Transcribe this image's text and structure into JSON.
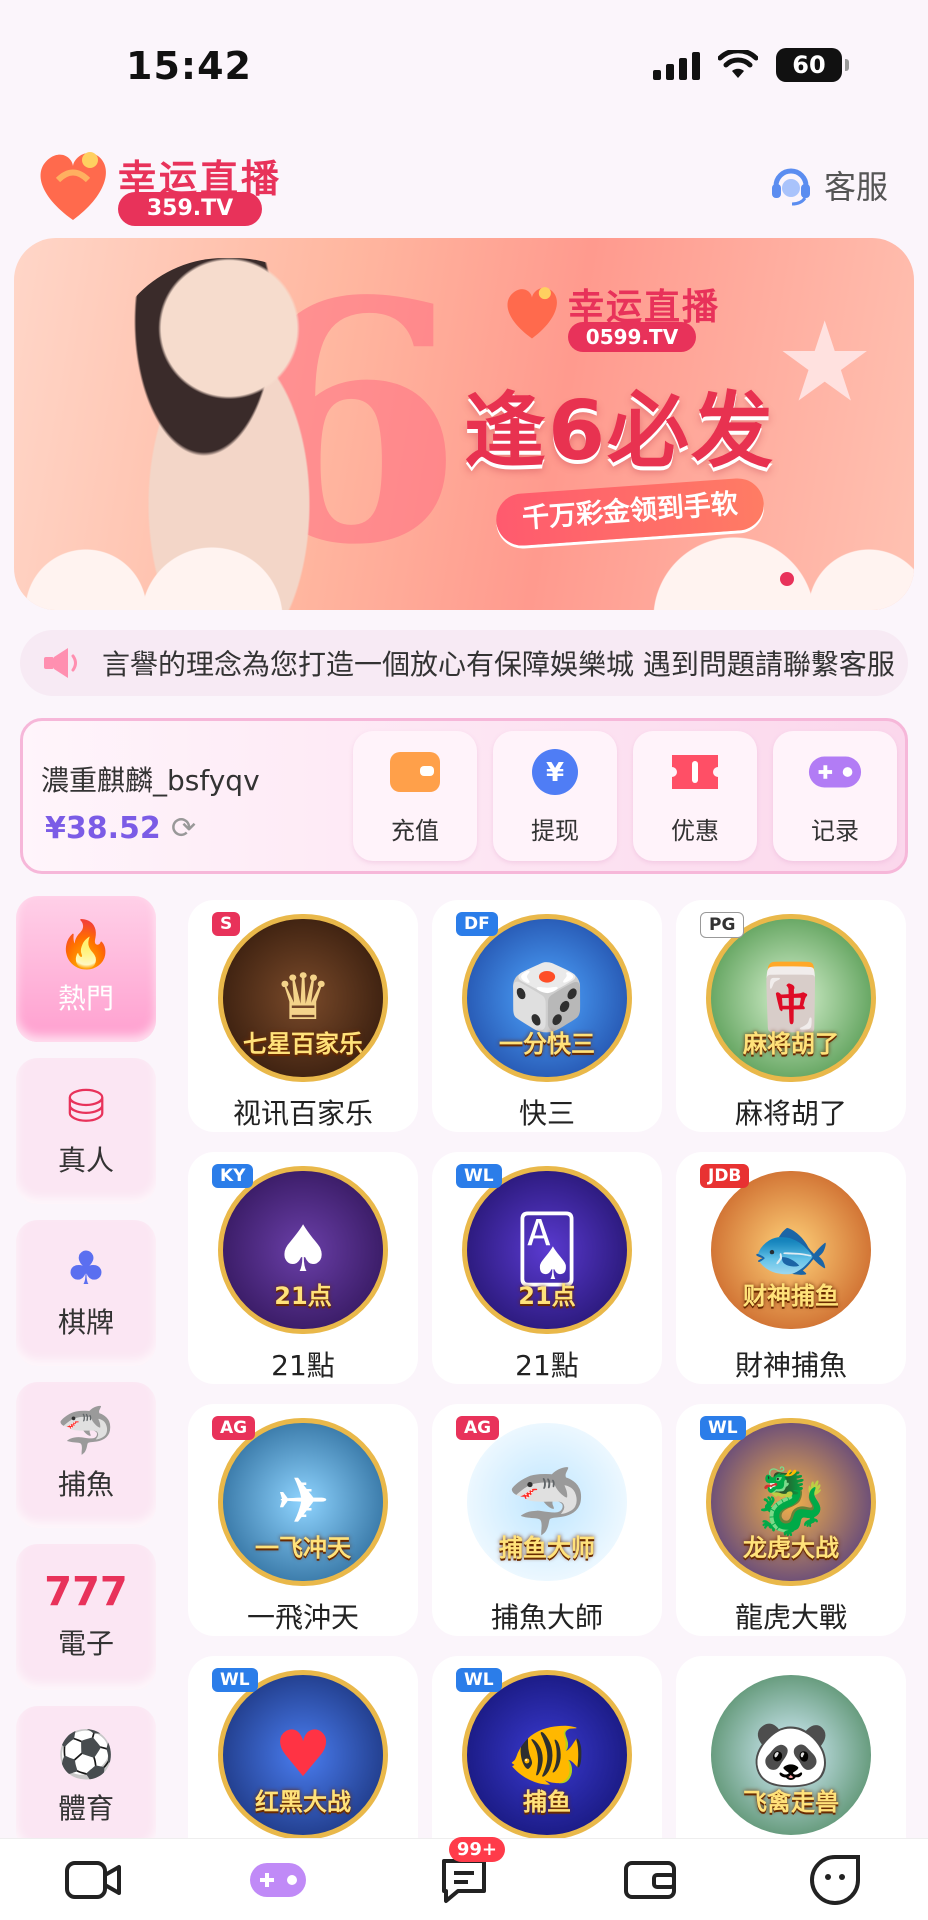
{
  "status_bar": {
    "time": "15:42",
    "battery": "60"
  },
  "header": {
    "logo_title": "幸运直播",
    "logo_sub": "359.TV",
    "service_label": "客服"
  },
  "banner": {
    "logo_title": "幸运直播",
    "logo_sub": "0599.TV",
    "headline": "逢6必发",
    "pill": "千万彩金领到手软",
    "big_number": "6"
  },
  "marquee": {
    "text": "言譽的理念為您打造一個放心有保障娛樂城  遇到問題請聯繫客服"
  },
  "account": {
    "username": "濃重麒麟_bsfyqv",
    "balance": "¥38.52",
    "actions": [
      {
        "label": "充值",
        "icon": "wallet-icon",
        "color": "#ff8f3c"
      },
      {
        "label": "提现",
        "icon": "yuan-coin-icon",
        "color": "#4f7df5"
      },
      {
        "label": "优惠",
        "icon": "ticket-icon",
        "color": "#ff4f66"
      },
      {
        "label": "记录",
        "icon": "gamepad-icon",
        "color": "#b27cf5"
      }
    ]
  },
  "categories": [
    {
      "label": "熱門",
      "icon": "flame-icon",
      "active": true
    },
    {
      "label": "真人",
      "icon": "poker-chip-icon",
      "active": false
    },
    {
      "label": "棋牌",
      "icon": "playing-cards-icon",
      "active": false
    },
    {
      "label": "捕魚",
      "icon": "shark-icon",
      "active": false
    },
    {
      "label": "電子",
      "icon": "slot-777-icon",
      "active": false
    },
    {
      "label": "體育",
      "icon": "soccer-ball-icon",
      "active": false
    }
  ],
  "games": [
    {
      "name": "视讯百家乐",
      "caption": "七星百家乐",
      "tag": "S",
      "art": "♛"
    },
    {
      "name": "快三",
      "caption": "一分快三",
      "tag": "DF",
      "art": "🎲"
    },
    {
      "name": "麻将胡了",
      "caption": "麻将胡了",
      "tag": "PG",
      "art": "🀄"
    },
    {
      "name": "21點",
      "caption": "21点",
      "tag": "KY",
      "art": "♠"
    },
    {
      "name": "21點",
      "caption": "21点",
      "tag": "WL",
      "art": "🂡"
    },
    {
      "name": "財神捕魚",
      "caption": "财神捕鱼",
      "tag": "JDB",
      "art": "🐟"
    },
    {
      "name": "一飛沖天",
      "caption": "一飞冲天",
      "tag": "AG",
      "art": "✈"
    },
    {
      "name": "捕魚大師",
      "caption": "捕鱼大师",
      "tag": "AG",
      "art": "🦈"
    },
    {
      "name": "龍虎大戰",
      "caption": "龙虎大战",
      "tag": "WL",
      "art": "🐉"
    },
    {
      "name": "",
      "caption": "红黑大战",
      "tag": "WL",
      "art": "♥"
    },
    {
      "name": "",
      "caption": "捕鱼",
      "tag": "WL",
      "art": "🐠"
    },
    {
      "name": "",
      "caption": "飞禽走兽",
      "tag": "",
      "art": "🐼"
    }
  ],
  "bottom_nav": [
    {
      "icon": "video-camera-icon"
    },
    {
      "icon": "gamepad-icon",
      "active": true
    },
    {
      "icon": "message-icon",
      "badge": "99+"
    },
    {
      "icon": "wallet-icon"
    },
    {
      "icon": "profile-face-icon"
    }
  ]
}
